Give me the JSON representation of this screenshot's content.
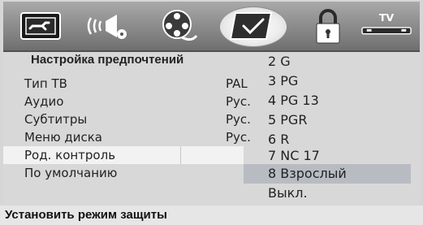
{
  "icons": [
    {
      "name": "general-setup-icon"
    },
    {
      "name": "audio-setup-icon"
    },
    {
      "name": "video-setup-icon"
    },
    {
      "name": "preferences-icon"
    },
    {
      "name": "password-lock-icon"
    },
    {
      "name": "tv-icon",
      "label": "TV"
    }
  ],
  "menu": {
    "title": "Настройка предпочтений",
    "items": [
      {
        "label": "Тип ТВ",
        "value": "PAL"
      },
      {
        "label": "Аудио",
        "value": "Рус."
      },
      {
        "label": "Субтитры",
        "value": "Рус."
      },
      {
        "label": "Меню диска",
        "value": "Рус."
      },
      {
        "label": "Род. контроль",
        "value": ""
      },
      {
        "label": "По умолчанию",
        "value": ""
      }
    ],
    "selected_index": 4
  },
  "options": [
    "2  G",
    "3  PG",
    "4  PG  13",
    "5  PGR",
    "6  R",
    "7  NC 17",
    "8  Взрослый",
    "Выкл."
  ],
  "highlighted_option_index": 6,
  "status": {
    "text": "Установить режим защиты"
  }
}
